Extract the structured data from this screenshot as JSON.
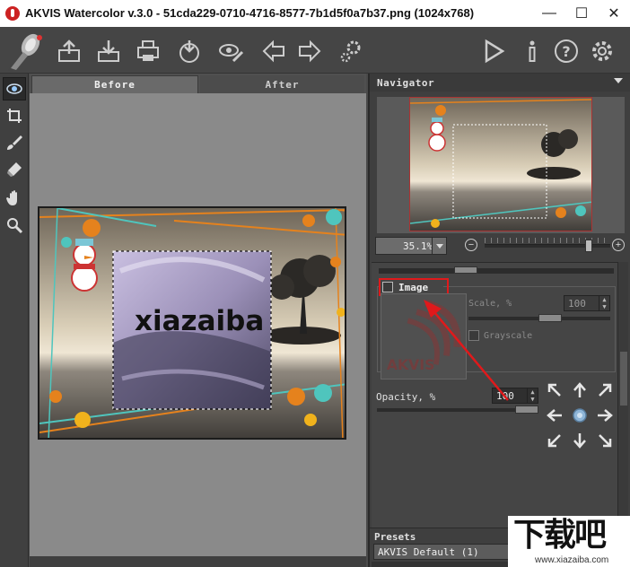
{
  "window": {
    "title": "AKVIS Watercolor v.3.0 - 51cda229-0710-4716-8577-7b1d5f0a7b37.png (1024x768)",
    "minimize": "—",
    "maximize": "☐",
    "close": "✕"
  },
  "toolbar": {
    "icons": [
      "logo-brush-icon",
      "open-icon",
      "save-icon",
      "print-icon",
      "share-icon",
      "batch-icon",
      "undo-arrow-icon",
      "redo-arrow-icon",
      "plugin-settings-icon",
      "run-icon",
      "info-icon",
      "help-icon",
      "preferences-icon"
    ]
  },
  "tools": [
    "preview-eye-icon",
    "crop-icon",
    "brush-icon",
    "eraser-icon",
    "hand-icon",
    "zoom-icon"
  ],
  "canvas": {
    "tabs": {
      "before": "Before",
      "after": "After"
    },
    "overlay_text": "xiazaiba"
  },
  "navigator": {
    "header": "Navigator",
    "zoom_value": "35.1%",
    "zoom_out": "−",
    "zoom_in": "+",
    "zoom_level_fraction": 0.83
  },
  "settings": {
    "image_checkbox_label": "Image",
    "image_checked": false,
    "preview_logo_text": "AKVIS",
    "scale_label": "Scale, %",
    "scale_value": "100",
    "grayscale_label": "Grayscale",
    "opacity_label": "Opacity, %",
    "opacity_value": "100",
    "spin_up": "▲",
    "spin_down": "▼"
  },
  "presets": {
    "header": "Presets",
    "selected": "AKVIS Default (1)"
  },
  "watermark": {
    "brand": "下载吧",
    "url": "www.xiazaiba.com"
  },
  "colors": {
    "highlight": "#e0191b",
    "arrow": "#e0191b",
    "panel": "#3f3f3f",
    "canvas_bg": "#8a8a8a"
  }
}
